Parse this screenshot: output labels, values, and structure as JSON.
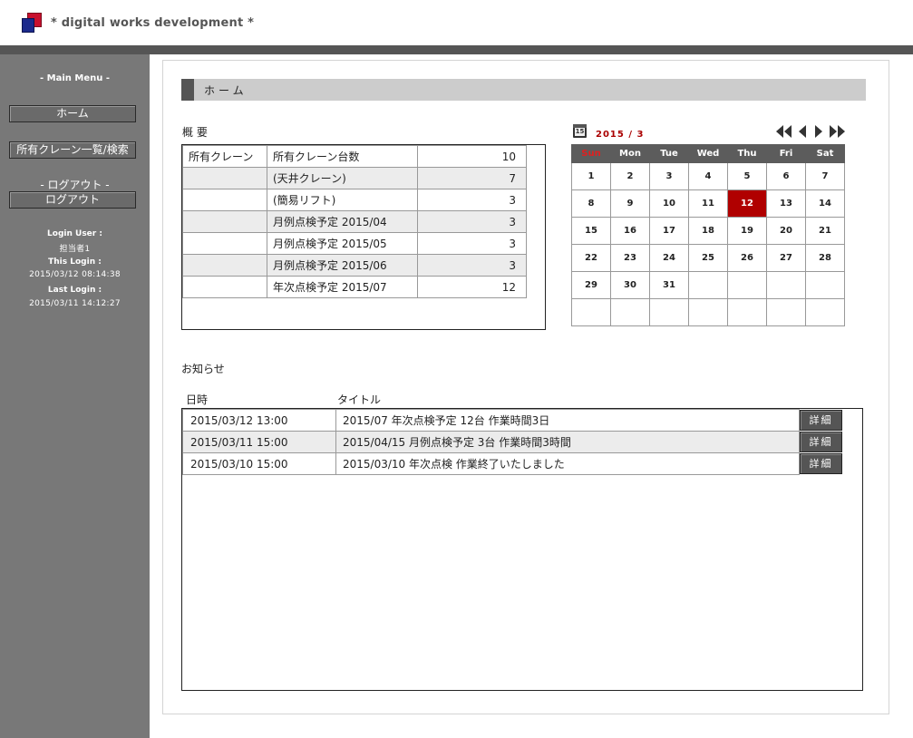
{
  "header": {
    "site_title": "* digital works development *"
  },
  "sidebar": {
    "main_menu_caption": "- Main Menu -",
    "home_button": "ホーム",
    "crane_list_button": "所有クレーン一覧/検索",
    "logout_caption": "- ログアウト -",
    "logout_button": "ログアウト",
    "login_user_label": "Login User :",
    "login_user_value": "担当者1",
    "this_login_label": "This Login :",
    "this_login_value": "2015/03/12 08:14:38",
    "last_login_label": "Last Login :",
    "last_login_value": "2015/03/11 14:12:27"
  },
  "main": {
    "page_title": "ホーム",
    "summary_label": "概 要",
    "summary_rows": [
      {
        "category": "所有クレーン",
        "item": "所有クレーン台数",
        "value": "10"
      },
      {
        "category": "",
        "item": "(天井クレーン)",
        "value": "7"
      },
      {
        "category": "",
        "item": "(簡易リフト)",
        "value": "3"
      },
      {
        "category": "",
        "item": "月例点検予定 2015/04",
        "value": "3"
      },
      {
        "category": "",
        "item": "月例点検予定 2015/05",
        "value": "3"
      },
      {
        "category": "",
        "item": "月例点検予定 2015/06",
        "value": "3"
      },
      {
        "category": "",
        "item": "年次点検予定 2015/07",
        "value": "12"
      }
    ],
    "news_label": "お知らせ",
    "news_col_date": "日時",
    "news_col_title": "タイトル",
    "news_rows": [
      {
        "date": "2015/03/12 13:00",
        "title": "2015/07 年次点検予定 12台 作業時間3日",
        "button": "詳細"
      },
      {
        "date": "2015/03/11 15:00",
        "title": "2015/04/15 月例点検予定 3台 作業時間3時間",
        "button": "詳細"
      },
      {
        "date": "2015/03/10 15:00",
        "title": "2015/03/10 年次点検 作業終了いたしました",
        "button": "詳細"
      }
    ]
  },
  "calendar": {
    "icon_day": "15",
    "title": "2015 / 3",
    "weekdays": [
      "Sun",
      "Mon",
      "Tue",
      "Wed",
      "Thu",
      "Fri",
      "Sat"
    ],
    "weeks": [
      [
        "1",
        "2",
        "3",
        "4",
        "5",
        "6",
        "7"
      ],
      [
        "8",
        "9",
        "10",
        "11",
        "12",
        "13",
        "14"
      ],
      [
        "15",
        "16",
        "17",
        "18",
        "19",
        "20",
        "21"
      ],
      [
        "22",
        "23",
        "24",
        "25",
        "26",
        "27",
        "28"
      ],
      [
        "29",
        "30",
        "31",
        "",
        "",
        "",
        ""
      ],
      [
        "",
        "",
        "",
        "",
        "",
        "",
        ""
      ]
    ],
    "today": "12",
    "today_color": "#b00000",
    "nav_icons": [
      "first-month-icon",
      "prev-month-icon",
      "next-month-icon",
      "last-month-icon"
    ]
  }
}
